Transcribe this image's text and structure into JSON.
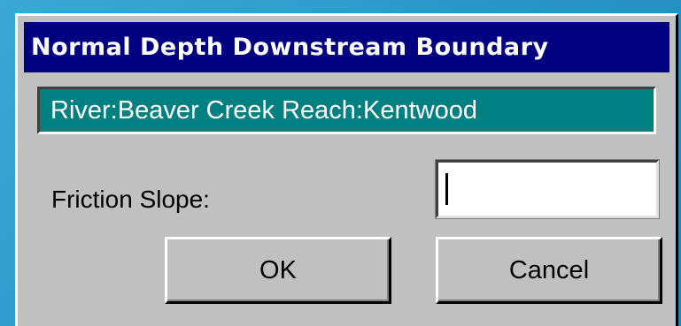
{
  "dialog": {
    "title": "Normal Depth Downstream Boundary",
    "location": "River:Beaver Creek Reach:Kentwood",
    "friction_slope": {
      "label": "Friction Slope:",
      "value": ""
    },
    "buttons": {
      "ok_label": "OK",
      "cancel_label": "Cancel"
    }
  },
  "colors": {
    "titlebar": "#000080",
    "location_bar": "#008080",
    "dialog_face": "#c0c0c0",
    "background": "#2f9fd0"
  }
}
